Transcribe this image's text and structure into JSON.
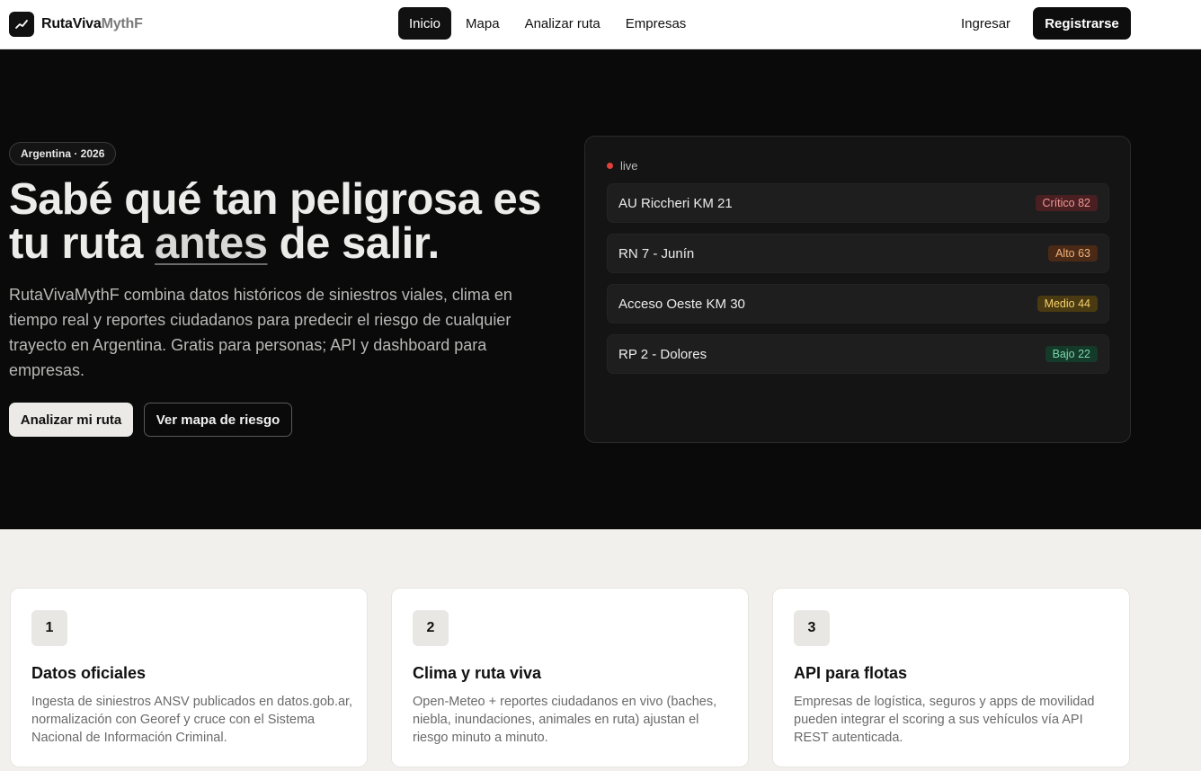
{
  "header": {
    "logo_bold": "RutaViva",
    "logo_light": "MythF",
    "nav": [
      {
        "label": "Inicio",
        "active": true
      },
      {
        "label": "Mapa",
        "active": false
      },
      {
        "label": "Analizar ruta",
        "active": false
      },
      {
        "label": "Empresas",
        "active": false
      }
    ],
    "login_label": "Ingresar",
    "signup_label": "Registrarse"
  },
  "hero": {
    "badge": "Argentina · 2026",
    "headline_part1": "Sabé qué tan peligrosa es tu ruta ",
    "headline_highlight": "antes",
    "headline_part2": " de salir.",
    "lead": "RutaVivaMythF combina datos históricos de siniestros viales, clima en tiempo real y reportes ciudadanos para predecir el riesgo de cualquier trayecto en Argentina. Gratis para personas; API y dashboard para empresas.",
    "primary_cta": "Analizar mi ruta",
    "secondary_cta": "Ver mapa de riesgo",
    "panel": {
      "live_label": "live",
      "routes": [
        {
          "name": "AU Riccheri KM 21",
          "level": "Crítico",
          "score": 82,
          "tag": "Crítico 82"
        },
        {
          "name": "RN 7 - Junín",
          "level": "Alto",
          "score": 63,
          "tag": "Alto 63"
        },
        {
          "name": "Acceso Oeste KM 30",
          "level": "Medio",
          "score": 44,
          "tag": "Medio 44"
        },
        {
          "name": "RP 2 - Dolores",
          "level": "Bajo",
          "score": 22,
          "tag": "Bajo 22"
        }
      ]
    }
  },
  "features": [
    {
      "number": "1",
      "title": "Datos oficiales",
      "description": "Ingesta de siniestros ANSV publicados en datos.gob.ar, normalización con Georef y cruce con el Sistema Nacional de Información Criminal."
    },
    {
      "number": "2",
      "title": "Clima y ruta viva",
      "description": "Open-Meteo + reportes ciudadanos en vivo (baches, niebla, inundaciones, animales en ruta) ajustan el riesgo minuto a minuto."
    },
    {
      "number": "3",
      "title": "API para flotas",
      "description": "Empresas de logística, seguros y apps de movilidad pueden integrar el scoring a sus vehículos vía API REST autenticada."
    }
  ],
  "colors": {
    "hero_bg": "#0a0a0a",
    "page_bg": "#f1f0ec",
    "live_dot": "#e0413b",
    "critico": "#f19893",
    "alto": "#f2b07a",
    "medio": "#f5cf6a",
    "bajo": "#79d6a8"
  },
  "icons": {
    "logo": "trend-line-icon"
  }
}
